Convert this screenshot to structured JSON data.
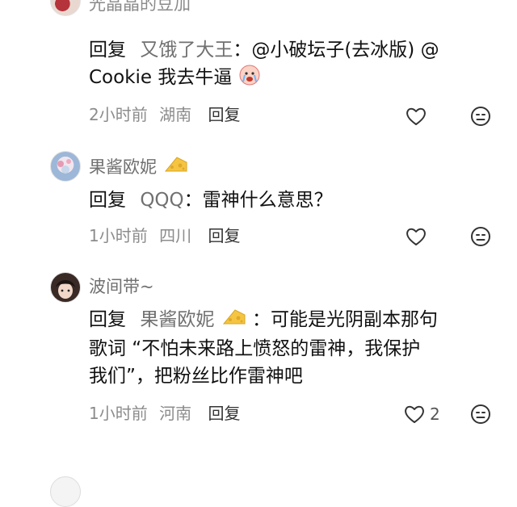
{
  "top_partial": {
    "username": "光晶晶的豆加"
  },
  "comments": [
    {
      "reply_keyword": "回复",
      "mention_user": "又饿了大王",
      "colon": "：",
      "content_line1_rest": "@小破坛子(去冰版) @",
      "content_line2": "Cookie  我去牛逼",
      "time": "2小时前",
      "location": "湖南",
      "reply_label": "回复"
    },
    {
      "username": "果酱欧妮",
      "reply_keyword": "回复",
      "mention_user": "QQQ",
      "colon": "：",
      "content": "雷神什么意思？",
      "time": "1小时前",
      "location": "四川",
      "reply_label": "回复"
    },
    {
      "username": "波间带~",
      "reply_keyword": "回复",
      "mention_user": "果酱欧妮",
      "colon": "：",
      "content_line1_rest": "可能是光阴副本那句",
      "content_line2": "歌词 “不怕未来路上愤怒的雷神，我保护",
      "content_line3": "我们”，把粉丝比作雷神吧",
      "time": "1小时前",
      "location": "河南",
      "reply_label": "回复",
      "like_count": "2"
    }
  ],
  "icons": {
    "like": "heart-outline-icon",
    "dislike": "neutral-face-icon",
    "badge": "cheese-icon",
    "emoji": "crying-face-emoji"
  },
  "colors": {
    "mention": "#707070",
    "meta": "#8c8c8c",
    "badge": "#f5c542"
  }
}
